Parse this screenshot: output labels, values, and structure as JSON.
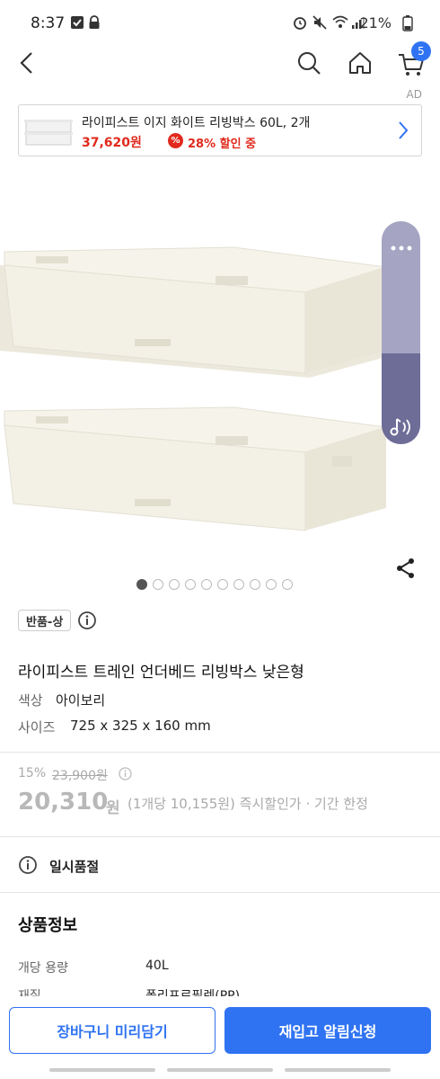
{
  "status_bar": {
    "time": "8:37",
    "battery": "21%"
  },
  "header": {
    "cart_count": "5",
    "ad_label": "AD"
  },
  "ad_banner": {
    "title": "라이피스트 이지 화이트 리빙박스 60L, 2개",
    "price": "37,620원",
    "discount_icon": "%",
    "discount_text": "28% 할인 중"
  },
  "gallery": {
    "total": 10,
    "current": 1
  },
  "product": {
    "badge": "반품-상",
    "name": "라이피스트 트레인 언더베드 리빙박스 낮은형",
    "options": [
      {
        "label": "색상",
        "value": "아이보리"
      },
      {
        "label": "사이즈",
        "value": "725 x 325 x 160 mm"
      }
    ],
    "discount_rate": "15%",
    "original_price": "23,900원",
    "price": "20,310",
    "price_unit": "원",
    "price_note": "(1개당 10,155원) 즉시할인가 · 기간 한정",
    "status": "일시품절"
  },
  "specs": {
    "title": "상품정보",
    "rows": [
      {
        "key": "개당 용량",
        "value": "40L"
      },
      {
        "key": "재질",
        "value": "폴리프로필렌(PP)"
      }
    ]
  },
  "actions": {
    "cart": "장바구니 미리담기",
    "restock": "재입고 알림신청"
  },
  "colors": {
    "accent": "#2f73f2",
    "sale": "#e0291c"
  }
}
